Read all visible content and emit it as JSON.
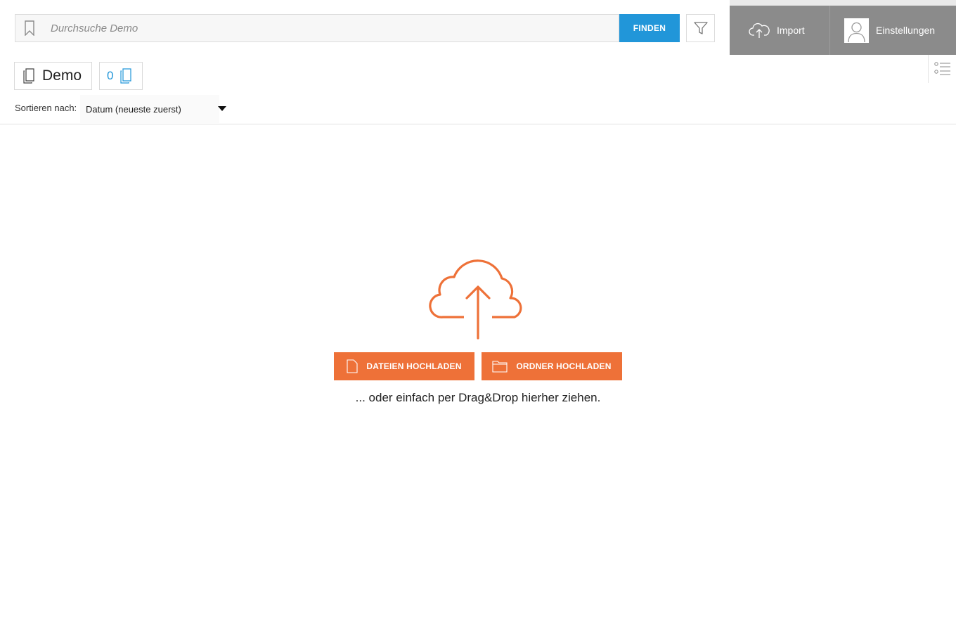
{
  "search": {
    "placeholder": "Durchsuche Demo",
    "find_label": "FINDEN"
  },
  "top_right": {
    "import_label": "Import",
    "settings_label": "Einstellungen"
  },
  "collection": {
    "title": "Demo",
    "count": "0"
  },
  "sort": {
    "label": "Sortieren nach:",
    "selected": "Datum (neueste zuerst)"
  },
  "upload": {
    "files_label": "DATEIEN HOCHLADEN",
    "folder_label": "ORDNER HOCHLADEN",
    "dnd_text": "... oder einfach per Drag&Drop hierher ziehen."
  },
  "icons": {
    "bookmark": "bookmark-icon",
    "filter": "filter-icon",
    "import": "cloud-upload-icon",
    "settings": "user-icon",
    "list": "list-view-icon",
    "collection": "documents-icon",
    "count": "documents-icon",
    "upload_cloud": "cloud-upload-icon",
    "file": "file-icon",
    "folder": "folder-icon"
  },
  "colors": {
    "primary_blue": "#2196d9",
    "accent_orange": "#ee7138",
    "panel_gray": "#8b8b8b"
  }
}
